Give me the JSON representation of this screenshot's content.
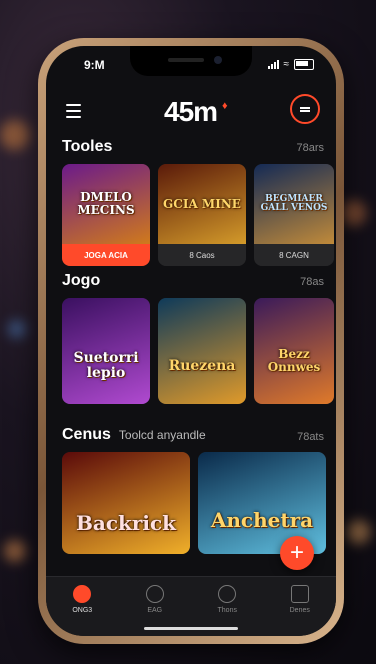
{
  "status": {
    "time": "9:M"
  },
  "header": {
    "logo": "45m"
  },
  "sections": [
    {
      "title": "Tooles",
      "subtitle": "",
      "count": "78ars",
      "cards": [
        {
          "art_title": "DMELO MECINS",
          "footer": "JOGA ACIA",
          "active": true,
          "colors": [
            "#6b1a8a",
            "#d07a1c"
          ]
        },
        {
          "art_title": "GCIA MINE",
          "footer": "8 Caos",
          "active": false,
          "colors": [
            "#5a1a0a",
            "#d39a2a"
          ]
        },
        {
          "art_title": "BEGMIAER GALL VENOS",
          "footer": "8 CAGN",
          "active": false,
          "colors": [
            "#142a55",
            "#c08a3a"
          ]
        }
      ]
    },
    {
      "title": "Jogo",
      "subtitle": "",
      "count": "78as",
      "cards": [
        {
          "art_title": "Suetorri lepio",
          "footer": "",
          "active": false,
          "colors": [
            "#3a1060",
            "#b04ad0"
          ]
        },
        {
          "art_title": "Ruezena",
          "footer": "",
          "active": false,
          "colors": [
            "#0e3a5a",
            "#e09a2a"
          ]
        },
        {
          "art_title": "Bezz Onnwes",
          "footer": "",
          "active": false,
          "colors": [
            "#3a1a5a",
            "#e07a2a"
          ]
        }
      ]
    },
    {
      "title": "Cenus",
      "subtitle": "Toolcd anyandle",
      "count": "78ats",
      "cards": [
        {
          "art_title": "Backrick",
          "footer": "",
          "active": false,
          "colors": [
            "#5a0a0a",
            "#f0b02a"
          ]
        },
        {
          "art_title": "Anchetra",
          "footer": "",
          "active": false,
          "colors": [
            "#0a2a4a",
            "#60c0e0"
          ]
        }
      ]
    }
  ],
  "fab": {
    "label": "+"
  },
  "tabs": [
    {
      "label": "ONG3",
      "icon": "chip-icon",
      "active": true
    },
    {
      "label": "EAG",
      "icon": "lock-icon",
      "active": false
    },
    {
      "label": "Thons",
      "icon": "power-icon",
      "active": false
    },
    {
      "label": "Denes",
      "icon": "list-icon",
      "active": false
    }
  ],
  "colors": {
    "accent": "#ff4a2a",
    "background": "#0f0f12"
  }
}
